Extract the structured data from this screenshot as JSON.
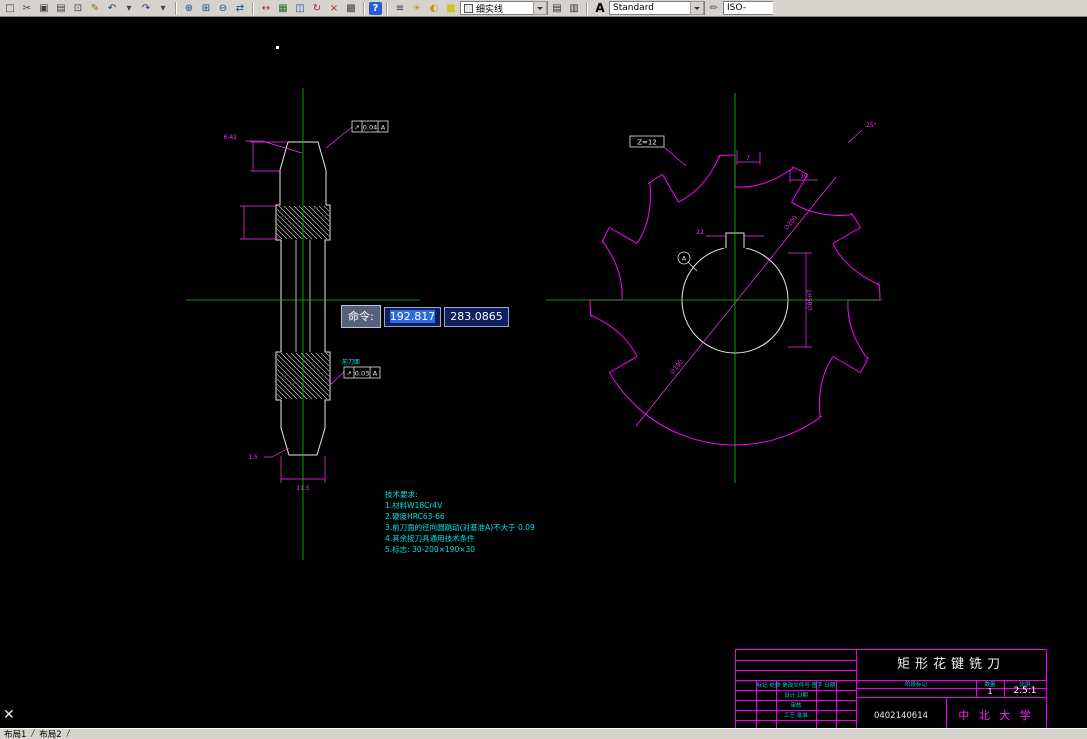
{
  "toolbar": {
    "groups": {
      "file": [
        {
          "name": "new-drawing-icon",
          "glyph": "□",
          "color": "#444"
        },
        {
          "name": "cut-icon",
          "glyph": "✂",
          "color": "#444"
        },
        {
          "name": "copy-icon",
          "glyph": "▣",
          "color": "#444"
        },
        {
          "name": "paste-icon",
          "glyph": "▤",
          "color": "#444"
        },
        {
          "name": "print-icon",
          "glyph": "⊡",
          "color": "#444"
        },
        {
          "name": "pencil-icon",
          "glyph": "✎",
          "color": "#8a6d1a"
        },
        {
          "name": "undo-icon",
          "glyph": "↶",
          "color": "#1a3c8a"
        },
        {
          "name": "undo-arrow-icon",
          "glyph": "▾",
          "color": "#444"
        },
        {
          "name": "redo-icon",
          "glyph": "↷",
          "color": "#1a3c8a"
        },
        {
          "name": "redo-arrow-icon",
          "glyph": "▾",
          "color": "#444"
        }
      ],
      "zoom": [
        {
          "name": "zoom-in-icon",
          "glyph": "⊕",
          "color": "#15508a"
        },
        {
          "name": "zoom-window-icon",
          "glyph": "⊞",
          "color": "#15508a"
        },
        {
          "name": "zoom-out-icon",
          "glyph": "⊖",
          "color": "#15508a"
        },
        {
          "name": "pan-icon",
          "glyph": "⇄",
          "color": "#15508a"
        }
      ],
      "modify": [
        {
          "name": "move-icon",
          "glyph": "↔",
          "color": "#a03030"
        },
        {
          "name": "array-icon",
          "glyph": "▦",
          "color": "#2a6a2a"
        },
        {
          "name": "mirror-icon",
          "glyph": "◫",
          "color": "#2a4a9a"
        },
        {
          "name": "rotate-icon",
          "glyph": "↻",
          "color": "#a03030"
        },
        {
          "name": "erase-icon",
          "glyph": "×",
          "color": "#c02020"
        },
        {
          "name": "table-icon",
          "glyph": "▩",
          "color": "#444"
        }
      ],
      "help": [
        {
          "name": "help-icon",
          "glyph": "?",
          "cls": "help"
        }
      ],
      "layers": [
        {
          "name": "layers-icon",
          "glyph": "≡",
          "color": "#333"
        },
        {
          "name": "layer-on-icon",
          "glyph": "☀",
          "color": "#c49a10"
        },
        {
          "name": "layer-half-icon",
          "glyph": "◐",
          "color": "#c49a10"
        },
        {
          "name": "layer-color-swatch",
          "glyph": "■",
          "color": "#c8c81e"
        }
      ],
      "layers2": [
        {
          "name": "layer-previous-icon",
          "glyph": "▤",
          "color": "#333"
        },
        {
          "name": "layer-states-icon",
          "glyph": "▥",
          "color": "#333"
        }
      ],
      "text": [
        {
          "name": "text-style-icon",
          "glyph": "A",
          "cls": "bold",
          "color": "#000"
        }
      ],
      "dim": [
        {
          "name": "dim-style-icon",
          "glyph": "✏",
          "color": "#555"
        }
      ]
    },
    "layer_combo": "细实线",
    "style_combo": "Standard",
    "dim_combo": "ISO-"
  },
  "canvas": {
    "ucs_glyph": "✕"
  },
  "tooltip": {
    "label": "命令:",
    "x": "192.817",
    "y": "283.0865"
  },
  "notes": {
    "lines": [
      "技术要求:",
      "1.材料W18Cr4V",
      "2.硬度HRC63-66",
      "3.前刀面的径向圆跳动(对基准A)不大于 0.09",
      "4.其余按刀具通用技术条件",
      "5.标志: 30-200×190×30"
    ]
  },
  "left_view": {
    "dim_tip": "6.42",
    "frame_top": {
      "sym": "↗",
      "val": "0.04",
      "datum": "A"
    },
    "frame_bot": {
      "sym": "↗",
      "val": "0.03",
      "datum": "A"
    },
    "rake_label": "前刀面",
    "dim_chamfer": "1.5",
    "dim_width": "11.5"
  },
  "right_view": {
    "teeth": "Z=12",
    "angle": "25°",
    "dim_a": "7",
    "dim_b": "10",
    "keyway": "22",
    "datum": "A",
    "bore": "∅85H7",
    "outer": "∅200",
    "root": "∅190"
  },
  "title_block": {
    "title": "矩形花键铣刀",
    "drawing_no": "0402140614",
    "org": "中 北 大 学",
    "qty": "1",
    "scale": "2.5:1",
    "hdr_stage": "阶段标记",
    "hdr_qty": "数量",
    "hdr_scale": "比例",
    "row1": "标记 处数 更改文件号 签字 日期",
    "row2": "设计      日期",
    "row3": "审核",
    "row4": "工艺      批准"
  },
  "statusbar": {
    "tab1": "布局1",
    "tab2": "布局2",
    "sep": "/"
  }
}
